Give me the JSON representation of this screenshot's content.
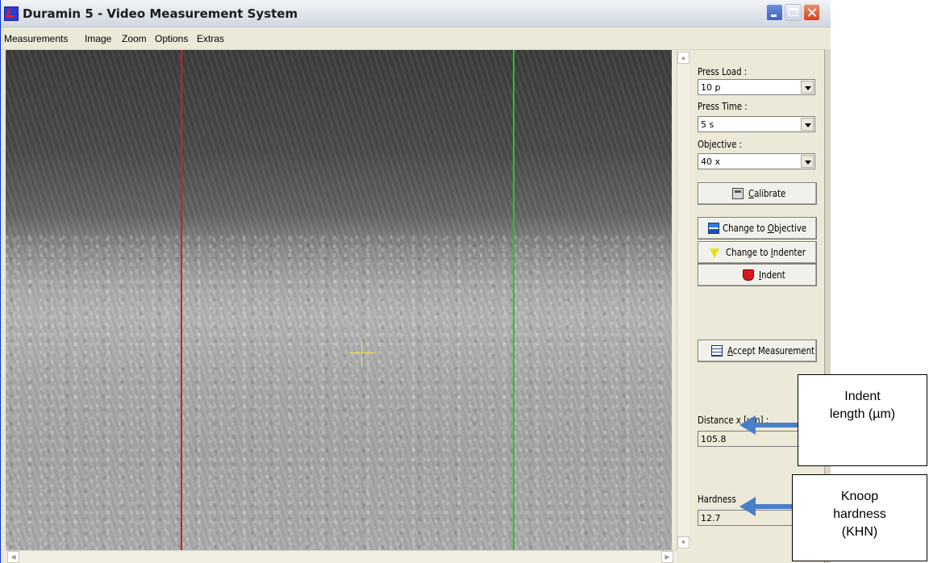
{
  "window": {
    "title": "Duramin 5 - Video Measurement System",
    "icon": "app-logo-icon",
    "controls": [
      "minimize-icon",
      "maximize-icon",
      "close-icon"
    ]
  },
  "menu": [
    "Measurements",
    "Image",
    "Zoom",
    "Options",
    "Extras"
  ],
  "viewport": {
    "overlay_colors": {
      "left_line": "#e01818",
      "right_line": "#17d017",
      "crosshair": "#f2e33a"
    }
  },
  "panel": {
    "press_load": {
      "label": "Press Load :",
      "value": "10 p"
    },
    "press_time": {
      "label": "Press Time :",
      "value": "5 s"
    },
    "objective": {
      "label": "Objective :",
      "value": "40 x"
    },
    "buttons": {
      "calibrate": "Calibrate",
      "change_objective": "Change to Objective",
      "change_indenter": "Change to Indenter",
      "indent": "Indent",
      "accept": "Accept Measurement"
    },
    "distance": {
      "label": "Distance x [µm] :",
      "value": "105.8"
    },
    "hardness": {
      "label": "Hardness",
      "value": "12.7"
    }
  },
  "annotations": {
    "indent_length": [
      "Indent",
      "length (µm)"
    ],
    "knoop": [
      "Knoop",
      "hardness",
      "(KHN)"
    ],
    "arrow_color": "#4a7ec7"
  }
}
